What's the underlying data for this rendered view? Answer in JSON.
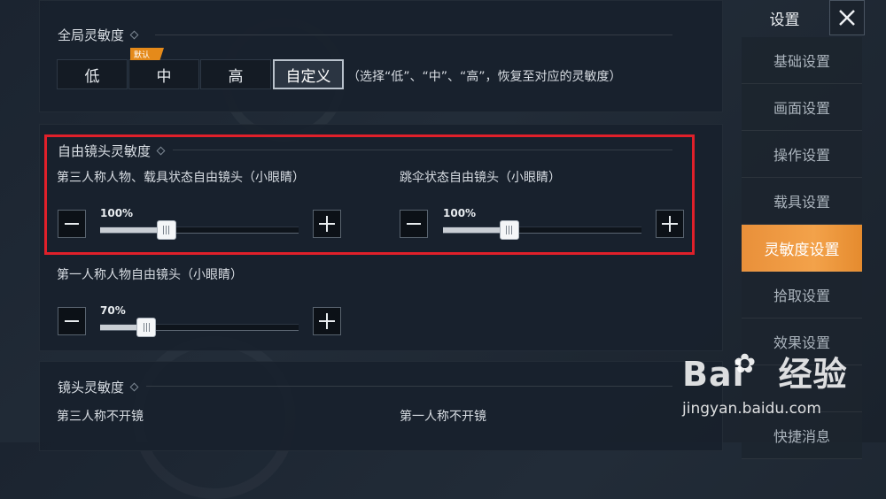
{
  "global": {
    "title": "全局灵敏度",
    "options": [
      "低",
      "中",
      "高",
      "自定义"
    ],
    "active_option": "自定义",
    "default_badge": "默认",
    "hint": "（选择“低”、“中”、“高”，恢复至对应的灵敏度）"
  },
  "free_camera": {
    "title": "自由镜头灵敏度",
    "third_person": {
      "label": "第三人称人物、载具状态自由镜头（小眼睛）",
      "value_text": "100%",
      "value": 1.0
    },
    "parachute": {
      "label": "跳伞状态自由镜头（小眼睛）",
      "value_text": "100%",
      "value": 1.0
    },
    "first_person": {
      "label": "第一人称人物自由镜头（小眼睛）",
      "value_text": "70%",
      "value": 0.7
    }
  },
  "camera": {
    "title": "镜头灵敏度",
    "col1": "第三人称不开镜",
    "col2": "第一人称不开镜"
  },
  "sidebar": {
    "title": "设置",
    "close_icon": "close-icon",
    "items": [
      "基础设置",
      "画面设置",
      "操作设置",
      "载具设置",
      "灵敏度设置",
      "拾取设置",
      "效果设置",
      "",
      "快捷消息"
    ],
    "active_item": "灵敏度设置"
  },
  "watermark": {
    "logo": "Bai",
    "logo2": "经验",
    "url": "jingyan.baidu.com"
  },
  "colors": {
    "accent": "#f09a42",
    "highlight_box": "#e0202a",
    "badge": "#e58a1a"
  }
}
